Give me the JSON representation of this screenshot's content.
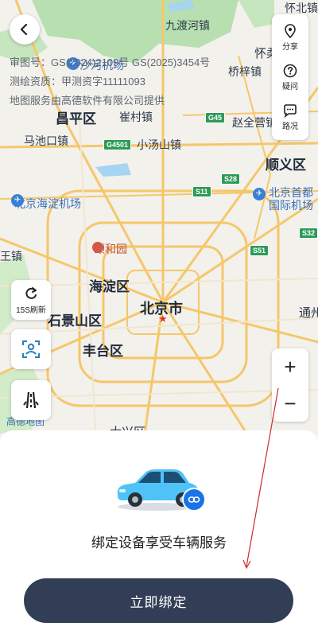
{
  "map": {
    "notices": [
      "审图号：GS(2024)2109号  GS(2025)3454号",
      "测绘资质：甲测资字11111093",
      "地图服务由高德软件有限公司提供"
    ],
    "places": {
      "huairou": "怀北镇",
      "jiudu": "九渡河镇",
      "huai": "怀柔",
      "qiaozi": "桥梓镇",
      "changping": "昌平区",
      "cuicun": "崔村镇",
      "zhaoquanying": "赵全营镇",
      "machikou": "马池口镇",
      "xiaotangshan": "小汤山镇",
      "shunyi": "顺义区",
      "haidian_airport": "北京海淀机场",
      "capital_airport_1": "北京首都",
      "capital_airport_2": "国际机场",
      "yiheyuan": "颐和园",
      "wangjiazhen": "王镇",
      "haidian": "海淀区",
      "beijing": "北京市",
      "shijingshan": "石景山区",
      "fengtai": "丰台区",
      "tongzhou": "通州",
      "daxing": "大兴区",
      "shahe": "沙河机场"
    },
    "shields": [
      "G45",
      "G4501",
      "S28",
      "S11",
      "S51",
      "S32"
    ],
    "logo": "高德地图"
  },
  "top": {
    "back_icon": "chevron-left-icon"
  },
  "right_panel": [
    {
      "label": "分享",
      "icon": "location-pin-icon"
    },
    {
      "label": "疑问",
      "icon": "question-icon"
    },
    {
      "label": "路况",
      "icon": "traffic-chat-icon"
    }
  ],
  "left_panel": {
    "refresh_label": "15S刷新",
    "refresh_icon": "refresh-icon",
    "person_icon": "person-locate-icon",
    "road_icon": "road-icon"
  },
  "zoom": {
    "plus": "+",
    "minus": "−"
  },
  "sheet": {
    "car_icon": "car-icon",
    "link_icon": "link-icon",
    "tagline": "绑定设备享受车辆服务",
    "button": "立即绑定"
  },
  "colors": {
    "button_bg": "#323e55",
    "link_badge": "#1a73e8",
    "car": "#4fc3f7"
  }
}
